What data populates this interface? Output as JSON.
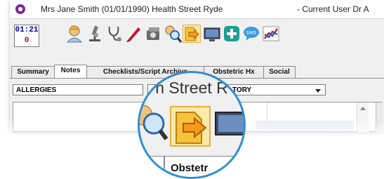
{
  "titlebar": {
    "patient": "Mrs Jane Smith (01/01/1990) Health Street Ryde",
    "current_user": "- Current User Dr A"
  },
  "clock": {
    "time": "01:21",
    "count": "0"
  },
  "toolbar": {
    "icons": [
      "patient-icon",
      "microscope-icon",
      "stethoscope-icon",
      "pen-icon",
      "tools-icon",
      "search-patient-icon",
      "import-icon",
      "monitor-icon",
      "add-icon",
      "sms-icon",
      "chart-icon"
    ]
  },
  "tabs": [
    {
      "label": "Summary",
      "active": false
    },
    {
      "label": "Notes",
      "active": true
    },
    {
      "label": "Checklists/Script Archive",
      "active": false
    },
    {
      "label": "Obstetric Hx",
      "active": false
    },
    {
      "label": "Social",
      "active": false
    }
  ],
  "combos": {
    "left": "ALLERGIES",
    "right": "TORY"
  },
  "magnifier": {
    "text": "h Street R",
    "tab": "Obstetr"
  },
  "colors": {
    "app": "#7b2a95",
    "time": "#0000a0",
    "count": "#d00000",
    "lens": "#2f8fd2"
  }
}
